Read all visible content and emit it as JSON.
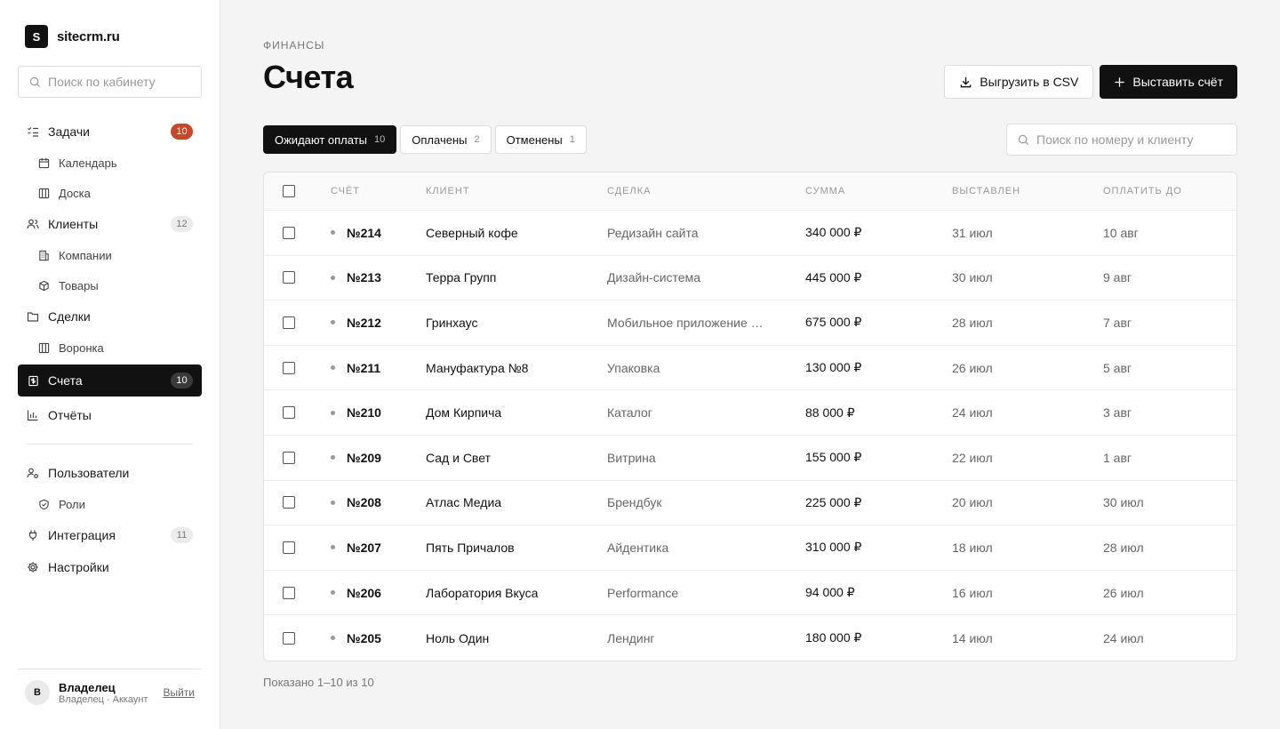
{
  "brand": {
    "logo_letter": "S",
    "name": "sitecrm.ru"
  },
  "sidebar": {
    "search_placeholder": "Поиск по кабинету",
    "items": [
      {
        "label": "Задачи",
        "icon": "tasks-icon",
        "badge": "10",
        "badge_style": "hot"
      },
      {
        "label": "Календарь",
        "icon": "calendar-icon",
        "sub": true
      },
      {
        "label": "Доска",
        "icon": "board-icon",
        "sub": true
      },
      {
        "label": "Клиенты",
        "icon": "users-icon",
        "badge": "12",
        "badge_style": "gray"
      },
      {
        "label": "Компании",
        "icon": "building-icon",
        "sub": true
      },
      {
        "label": "Товары",
        "icon": "box-icon",
        "sub": true
      },
      {
        "label": "Сделки",
        "icon": "folder-icon"
      },
      {
        "label": "Воронка",
        "icon": "funnel-board-icon",
        "sub": true
      },
      {
        "label": "Счета",
        "icon": "invoice-icon",
        "badge": "10",
        "badge_style": "dark",
        "active": true
      },
      {
        "label": "Отчёты",
        "icon": "chart-icon"
      }
    ],
    "items2": [
      {
        "label": "Пользователи",
        "icon": "user-settings-icon"
      },
      {
        "label": "Роли",
        "icon": "shield-icon",
        "sub": true
      },
      {
        "label": "Интеграция",
        "icon": "plug-icon",
        "badge": "11",
        "badge_style": "gray"
      },
      {
        "label": "Настройки",
        "icon": "gear-icon"
      }
    ]
  },
  "user": {
    "initial": "В",
    "name": "Владелец",
    "role": "Владелец · Аккаунт",
    "logout": "Выйти"
  },
  "page": {
    "breadcrumb": "ФИНАНСЫ",
    "title": "Счета",
    "export_label": "Выгрузить в CSV",
    "create_label": "Выставить счёт",
    "search_placeholder": "Поиск по номеру и клиенту",
    "footer": "Показано 1–10 из 10"
  },
  "tabs": [
    {
      "label": "Ожидают оплаты",
      "count": "10",
      "active": true
    },
    {
      "label": "Оплачены",
      "count": "2"
    },
    {
      "label": "Отменены",
      "count": "1"
    }
  ],
  "table": {
    "headers": [
      "СЧЁТ",
      "КЛИЕНТ",
      "СДЕЛКА",
      "СУММА",
      "ВЫСТАВЛЕН",
      "ОПЛАТИТЬ ДО"
    ],
    "rows": [
      {
        "num": "№214",
        "client": "Северный кофе",
        "deal": "Редизайн сайта",
        "sum": "340 000 ₽",
        "issued": "31 июл",
        "due": "10 авг"
      },
      {
        "num": "№213",
        "client": "Терра Групп",
        "deal": "Дизайн-система",
        "sum": "445 000 ₽",
        "issued": "30 июл",
        "due": "9 авг"
      },
      {
        "num": "№212",
        "client": "Гринхаус",
        "deal": "Мобильное приложение …",
        "sum": "675 000 ₽",
        "issued": "28 июл",
        "due": "7 авг"
      },
      {
        "num": "№211",
        "client": "Мануфактура №8",
        "deal": "Упаковка",
        "sum": "130 000 ₽",
        "issued": "26 июл",
        "due": "5 авг"
      },
      {
        "num": "№210",
        "client": "Дом Кирпича",
        "deal": "Каталог",
        "sum": "88 000 ₽",
        "issued": "24 июл",
        "due": "3 авг"
      },
      {
        "num": "№209",
        "client": "Сад и Свет",
        "deal": "Витрина",
        "sum": "155 000 ₽",
        "issued": "22 июл",
        "due": "1 авг"
      },
      {
        "num": "№208",
        "client": "Атлас Медиа",
        "deal": "Брендбук",
        "sum": "225 000 ₽",
        "issued": "20 июл",
        "due": "30 июл"
      },
      {
        "num": "№207",
        "client": "Пять Причалов",
        "deal": "Айдентика",
        "sum": "310 000 ₽",
        "issued": "18 июл",
        "due": "28 июл"
      },
      {
        "num": "№206",
        "client": "Лаборатория Вкуса",
        "deal": "Performance",
        "sum": "94 000 ₽",
        "issued": "16 июл",
        "due": "26 июл"
      },
      {
        "num": "№205",
        "client": "Ноль Один",
        "deal": "Лендинг",
        "sum": "180 000 ₽",
        "issued": "14 июл",
        "due": "24 июл"
      }
    ]
  }
}
